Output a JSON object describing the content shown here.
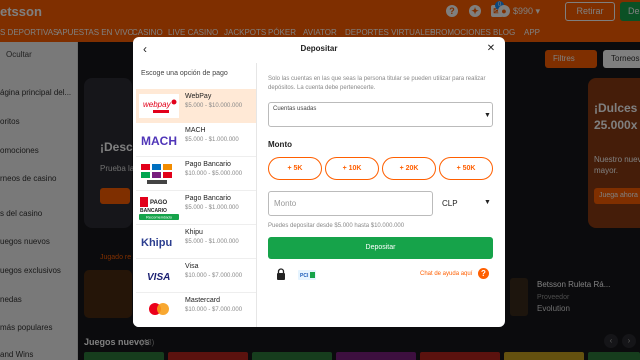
{
  "topbar": {
    "logo": "etsson",
    "badge_count": "0",
    "balance": "$990 ▾",
    "retirar_label": "Retirar",
    "depositar_short": "De"
  },
  "nav": [
    "S DEPORTIVAS",
    "APUESTAS EN VIVO",
    "CASINO",
    "LIVE CASINO",
    "JACKPOTS",
    "PÓKER",
    "AVIATOR",
    "DEPORTES VIRTUALES",
    "PROMOCIONES",
    "BLOG",
    "APP"
  ],
  "sidebar": {
    "hide_label": "Ocultar",
    "items": [
      "ágina principal del...",
      "oritos",
      "omociones",
      "rneos de casino",
      "s del casino",
      "uegos nuevos",
      "uegos exclusivos",
      "nedas",
      "más populares",
      "and Wins"
    ]
  },
  "filters": {
    "filtros": "Filtres",
    "torneos": "Torneos"
  },
  "banners": {
    "left_title": "¡Desc",
    "left_sub": "Prueba la",
    "right_title": "¡Dulces\n25.000x",
    "right_sub": "Nuestro nuevo\nmayor.",
    "right_button": "Juega ahora"
  },
  "recent": {
    "label": "Jugado re",
    "game_title": "Betsson Ruleta Rá...",
    "provider_label": "Proveedor",
    "provider": "Evolution"
  },
  "new_games": {
    "label": "Juegos nuevos",
    "count": "(48)"
  },
  "modal": {
    "title": "Depositar",
    "list_title": "Escoge una opción de pago",
    "methods": [
      {
        "name": "WebPay",
        "range": "$5.000 - $10.000.000",
        "logo": "webpay-logo",
        "selected": true
      },
      {
        "name": "MACH",
        "range": "$5.000 - $1.000.000",
        "logo": "mach-logo"
      },
      {
        "name": "Pago Bancario",
        "range": "$10.000 - $5.000.000",
        "logo": "khipu-multi-logo"
      },
      {
        "name": "Pago Bancario",
        "range": "$5.000 - $1.000.000",
        "logo": "pago-bancario-logo",
        "badge": "Recomendado"
      },
      {
        "name": "Khipu",
        "range": "$5.000 - $1.000.000",
        "logo": "khipu-logo"
      },
      {
        "name": "Visa",
        "range": "$10.000 - $7.000.000",
        "logo": "visa-logo"
      },
      {
        "name": "Mastercard",
        "range": "$10.000 - $7.000.000",
        "logo": "mastercard-logo"
      }
    ],
    "notice": "Solo las cuentas en las que seas la persona titular se pueden utilizar para realizar depósitos. La cuenta debe pertenecerte.",
    "accounts_label": "Cuentas usadas",
    "monto_label": "Monto",
    "quick_amounts": [
      "+ 5K",
      "+ 10K",
      "+ 20K",
      "+ 50K"
    ],
    "amount_placeholder": "Monto",
    "currency": "CLP",
    "hint": "Puedes depositar desde $5.000 hasta $10.000.000",
    "deposit_button": "Depositar",
    "chat_link": "Chat de ayuda aquí",
    "help_glyph": "?"
  },
  "colors": {
    "brand": "#ff5f00",
    "success": "#16a34a",
    "selected_bg": "#ffe9d6"
  }
}
